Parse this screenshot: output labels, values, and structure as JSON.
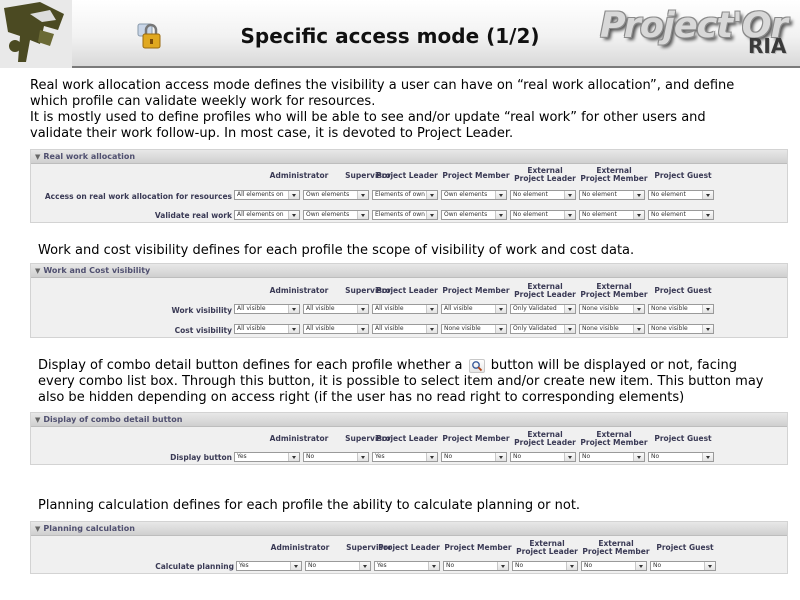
{
  "header": {
    "title": "Specific access mode (1/2)",
    "brand": "Project'Or",
    "brand_suffix": "RIA",
    "icons": [
      "logo-icon",
      "lock-icon"
    ]
  },
  "intro": {
    "lines": [
      "Real work allocation access mode defines the visibility a user can have on “real work allocation”, and define",
      "which profile can validate weekly work for resources.",
      "It is mostly used to define profiles who will be able to see and/or update “real work” for other users and",
      "validate their work follow-up. In most case, it is devoted to Project Leader."
    ]
  },
  "columns": {
    "administrator": "Administrator",
    "supervisor": "Supervisor",
    "project_leader": "Project Leader",
    "project_member": "Project Member",
    "external_leader_1": "External",
    "external_leader_2": "Project Leader",
    "external_member_1": "External",
    "external_member_2": "Project Member",
    "project_guest": "Project Guest"
  },
  "panel_real_work": {
    "title": "Real work allocation",
    "rows": [
      {
        "label": "Access on real work allocation for resources",
        "values": [
          "All elements on",
          "Own elements",
          "Elements of own",
          "Own elements",
          "No element",
          "No element",
          "No element"
        ]
      },
      {
        "label": "Validate real work",
        "values": [
          "All elements on",
          "Own elements",
          "Elements of own",
          "Own elements",
          "No element",
          "No element",
          "No element"
        ]
      }
    ]
  },
  "para_work_cost": {
    "lines": [
      "Work and cost visibility defines for each profile the scope of visibility of work and cost data."
    ]
  },
  "panel_work_cost": {
    "title": "Work and Cost visibility",
    "rows": [
      {
        "label": "Work visibility",
        "values": [
          "All visible",
          "All visible",
          "All visible",
          "All visible",
          "Only Validated",
          "None visible",
          "None visible"
        ]
      },
      {
        "label": "Cost visibility",
        "values": [
          "All visible",
          "All visible",
          "All visible",
          "None visible",
          "Only Validated",
          "None visible",
          "None visible"
        ]
      }
    ]
  },
  "para_combo": {
    "line1_before": "Display of combo detail button defines for each profile whether a",
    "line1_after": "button will be displayed or not, facing",
    "line2": "every combo list box. Through this button, it is possible to select item and/or create new item. This button may",
    "line3": "also be hidden depending on access right (if the user has no read right to corresponding elements)"
  },
  "panel_combo": {
    "title": "Display of combo detail button",
    "rows": [
      {
        "label": "Display button",
        "values": [
          "Yes",
          "No",
          "Yes",
          "No",
          "No",
          "No",
          "No"
        ]
      }
    ]
  },
  "para_planning": {
    "lines": [
      "Planning calculation defines for each profile the ability to calculate planning or not."
    ]
  },
  "panel_planning": {
    "title": "Planning calculation",
    "rows": [
      {
        "label": "Calculate planning",
        "values": [
          "Yes",
          "No",
          "Yes",
          "No",
          "No",
          "No",
          "No"
        ]
      }
    ]
  }
}
